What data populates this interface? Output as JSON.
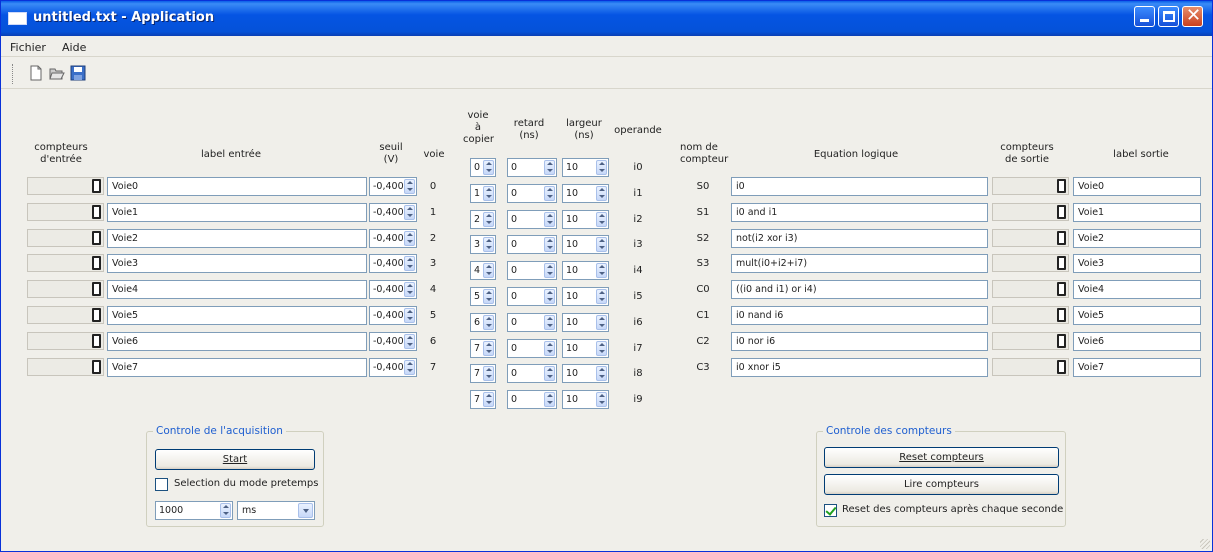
{
  "window": {
    "title": "untitled.txt - Application"
  },
  "menu": [
    "Fichier",
    "Aide"
  ],
  "toolbar": {
    "icons": [
      "new-file-icon",
      "open-folder-icon",
      "save-icon"
    ]
  },
  "inputs_header": {
    "counters": "compteurs\nd'entrée",
    "label": "label entrée",
    "threshold": "seuil\n(V)",
    "channel": "voie"
  },
  "inputs": [
    {
      "label": "Voie0",
      "seuil": "-0,400",
      "voie": "0"
    },
    {
      "label": "Voie1",
      "seuil": "-0,400",
      "voie": "1"
    },
    {
      "label": "Voie2",
      "seuil": "-0,400",
      "voie": "2"
    },
    {
      "label": "Voie3",
      "seuil": "-0,400",
      "voie": "3"
    },
    {
      "label": "Voie4",
      "seuil": "-0,400",
      "voie": "4"
    },
    {
      "label": "Voie5",
      "seuil": "-0,400",
      "voie": "5"
    },
    {
      "label": "Voie6",
      "seuil": "-0,400",
      "voie": "6"
    },
    {
      "label": "Voie7",
      "seuil": "-0,400",
      "voie": "7"
    }
  ],
  "operands_header": {
    "copy": "voie\nà\ncopier",
    "delay": "retard\n(ns)",
    "width": "largeur\n(ns)",
    "operand": "operande"
  },
  "operands": [
    {
      "voie": "0",
      "retard": "0",
      "largeur": "10",
      "op": "i0"
    },
    {
      "voie": "1",
      "retard": "0",
      "largeur": "10",
      "op": "i1"
    },
    {
      "voie": "2",
      "retard": "0",
      "largeur": "10",
      "op": "i2"
    },
    {
      "voie": "3",
      "retard": "0",
      "largeur": "10",
      "op": "i3"
    },
    {
      "voie": "4",
      "retard": "0",
      "largeur": "10",
      "op": "i4"
    },
    {
      "voie": "5",
      "retard": "0",
      "largeur": "10",
      "op": "i5"
    },
    {
      "voie": "6",
      "retard": "0",
      "largeur": "10",
      "op": "i6"
    },
    {
      "voie": "7",
      "retard": "0",
      "largeur": "10",
      "op": "i7"
    },
    {
      "voie": "7",
      "retard": "0",
      "largeur": "10",
      "op": "i8"
    },
    {
      "voie": "7",
      "retard": "0",
      "largeur": "10",
      "op": "i9"
    }
  ],
  "outputs_header": {
    "name": "nom de\ncompteur",
    "equation": "Equation logique",
    "counters": "compteurs\nde sortie",
    "label": "label sortie"
  },
  "outputs": [
    {
      "name": "S0",
      "eq": "i0",
      "label": "Voie0"
    },
    {
      "name": "S1",
      "eq": "i0 and i1",
      "label": "Voie1"
    },
    {
      "name": "S2",
      "eq": "not(i2 xor i3)",
      "label": "Voie2"
    },
    {
      "name": "S3",
      "eq": "mult(i0+i2+i7)",
      "label": "Voie3"
    },
    {
      "name": "C0",
      "eq": "((i0 and i1) or i4)",
      "label": "Voie4"
    },
    {
      "name": "C1",
      "eq": "i0 nand i6",
      "label": "Voie5"
    },
    {
      "name": "C2",
      "eq": "i0 nor i6",
      "label": "Voie6"
    },
    {
      "name": "C3",
      "eq": "i0 xnor i5",
      "label": "Voie7"
    }
  ],
  "acquisition": {
    "title": "Controle de l'acquisition",
    "start": "Start",
    "pretrig_label": "Selection du mode pretemps",
    "pretrig_checked": false,
    "time_value": "1000",
    "time_unit": "ms"
  },
  "counters_ctrl": {
    "title": "Controle des compteurs",
    "reset": "Reset compteurs",
    "read": "Lire compteurs",
    "reset_each_label": "Reset des compteurs après chaque seconde",
    "reset_each_checked": true
  }
}
